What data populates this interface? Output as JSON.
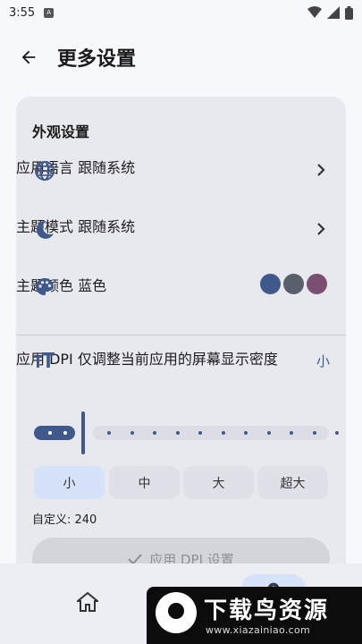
{
  "status_bar": {
    "time": "3:55",
    "notification_badge": "A"
  },
  "header": {
    "title": "更多设置"
  },
  "appearance": {
    "section_title": "外观设置",
    "language": {
      "label": "应用语言",
      "value": "跟随系统"
    },
    "theme_mode": {
      "label": "主题模式",
      "value": "跟随系统"
    },
    "theme_color": {
      "label": "主题颜色",
      "value": "蓝色",
      "swatches": [
        "#3f5a8a",
        "#5a5f6e",
        "#7a4f72"
      ]
    }
  },
  "dpi": {
    "label": "应用 DPI",
    "description": "仅调整当前应用的屏幕显示密度",
    "current_value": "小",
    "slider_level": 0.0,
    "options": [
      "小",
      "中",
      "大",
      "超大"
    ],
    "selected_option": "小",
    "custom_text": "自定义: 240",
    "apply_label": "应用 DPI 设置"
  },
  "watermark": {
    "title": "下载鸟资源",
    "url": "www.xiazainiao.com"
  },
  "colors": {
    "accent": "#3f5a8a",
    "selected_bg": "#d6e2fa",
    "card_bg": "#e8e9ee"
  }
}
